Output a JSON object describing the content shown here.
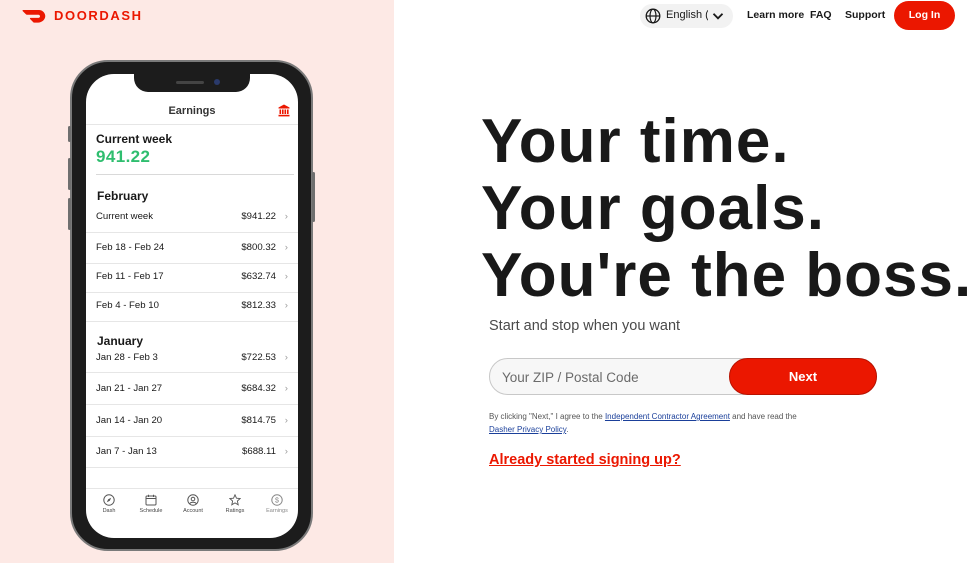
{
  "brand": {
    "name": "DOORDASH",
    "color": "#eb1700"
  },
  "nav": {
    "language": "English (US)",
    "links": [
      "Learn more",
      "FAQ",
      "Support"
    ],
    "login": "Log In"
  },
  "phone": {
    "title": "Earnings",
    "current_week_label": "Current week",
    "current_week_amount": "941.22",
    "months": [
      {
        "name": "February",
        "rows": [
          {
            "label": "Current week",
            "value": "$941.22"
          },
          {
            "label": "Feb 18 - Feb 24",
            "value": "$800.32"
          },
          {
            "label": "Feb 11 - Feb 17",
            "value": "$632.74"
          },
          {
            "label": "Feb 4 - Feb 10",
            "value": "$812.33"
          }
        ]
      },
      {
        "name": "January",
        "rows": [
          {
            "label": "Jan 28 - Feb 3",
            "value": "$722.53"
          },
          {
            "label": "Jan 21 - Jan 27",
            "value": "$684.32"
          },
          {
            "label": "Jan 14 - Jan 20",
            "value": "$814.75"
          },
          {
            "label": "Jan 7 - Jan 13",
            "value": "$688.11"
          }
        ]
      }
    ],
    "tabs": [
      {
        "label": "Dash",
        "icon": "compass-icon"
      },
      {
        "label": "Schedule",
        "icon": "calendar-icon"
      },
      {
        "label": "Account",
        "icon": "account-icon"
      },
      {
        "label": "Ratings",
        "icon": "star-icon"
      },
      {
        "label": "Earnings",
        "icon": "dollar-icon"
      }
    ],
    "earnings_color": "#2fbe6f"
  },
  "hero": {
    "lines": [
      "Your time.",
      "Your goals.",
      "You're the boss."
    ],
    "subtitle": "Start and stop when you want"
  },
  "signup": {
    "zip_placeholder": "Your ZIP / Postal Code",
    "next_label": "Next",
    "legal_prefix": "By clicking \"Next,\" I agree to the ",
    "agreement_link": "Independent Contractor Agreement",
    "legal_middle": " and have read the ",
    "privacy_link": "Dasher Privacy Policy",
    "legal_suffix": ".",
    "already": "Already started signing up?"
  }
}
